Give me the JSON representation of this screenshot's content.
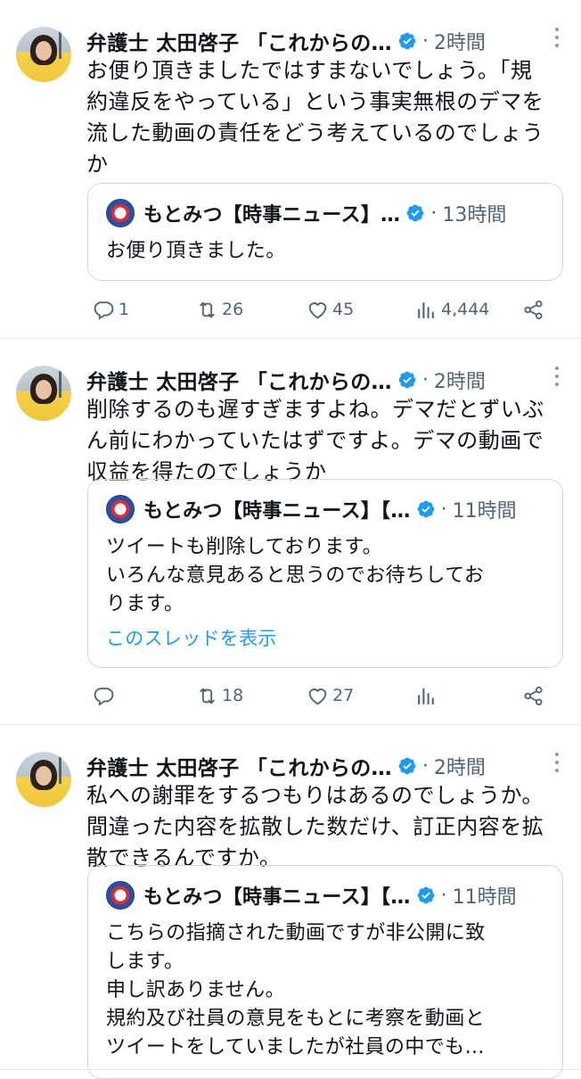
{
  "tweets": [
    {
      "author": "弁護士 太田啓子 「これからの…",
      "time": "2時間",
      "text_lines": [
        "お便り頂きましたではすまないでしょう。「規",
        "約違反をやっている」という事実無根のデマを",
        "流した動画の責任をどう考えているのでしょう",
        "か"
      ],
      "quote": {
        "author": "もとみつ【時事ニュース】…",
        "time": "13時間",
        "lines": [
          "お便り頂きました。"
        ],
        "show_thread": ""
      },
      "stats": {
        "replies": "1",
        "retweets": "26",
        "likes": "45",
        "views": "4,444"
      }
    },
    {
      "author": "弁護士 太田啓子 「これからの…",
      "time": "2時間",
      "text_lines": [
        "削除するのも遅すぎますよね。デマだとずいぶ",
        "ん前にわかっていたはずですよ。デマの動画で",
        "収益を得たのでしょうか"
      ],
      "quote": {
        "author": "もとみつ【時事ニュース】【…",
        "time": "11時間",
        "lines": [
          "ツイートも削除しております。",
          "いろんな意見あると思うのでお待ちしてお",
          "ります。"
        ],
        "show_thread": "このスレッドを表示"
      },
      "stats": {
        "replies": "",
        "retweets": "18",
        "likes": "27",
        "views": ""
      }
    },
    {
      "author": "弁護士 太田啓子 「これからの…",
      "time": "2時間",
      "text_lines": [
        "私への謝罪をするつもりはあるのでしょうか。",
        "間違った内容を拡散した数だけ、訂正内容を拡",
        "散できるんですか。"
      ],
      "quote": {
        "author": "もとみつ【時事ニュース】【…",
        "time": "11時間",
        "lines": [
          "こちらの指摘された動画ですが非公開に致",
          "します。",
          "申し訳ありません。",
          "規約及び社員の意見をもとに考察を動画と",
          "ツイートをしていましたが社員の中でも…"
        ],
        "show_thread": ""
      },
      "stats": {
        "replies": "",
        "retweets": "",
        "likes": "",
        "views": ""
      }
    }
  ],
  "separator": "·",
  "colors": {
    "verified": "#1d9bf0",
    "link": "#1d9bf0",
    "muted": "#536471",
    "border": "#cfd9de"
  }
}
